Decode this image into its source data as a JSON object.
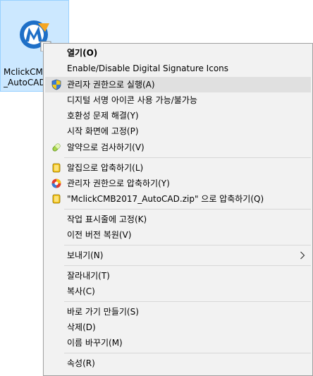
{
  "desktop_icon": {
    "label": "MclickCMB\n_AutoCAD"
  },
  "menu": {
    "items": [
      {
        "label": "열기(O)"
      },
      {
        "label": "Enable/Disable Digital Signature Icons"
      },
      {
        "label": "관리자 권한으로 실행(A)",
        "icon": "shield-icon"
      },
      {
        "label": "디지털 서명 아이콘 사용 가능/불가능"
      },
      {
        "label": "호환성 문제 해결(Y)"
      },
      {
        "label": "시작 화면에 고정(P)"
      },
      {
        "label": "알약으로 검사하기(V)",
        "icon": "pill-icon"
      },
      {
        "label": "알집으로 압축하기(L)",
        "icon": "alzip-icon"
      },
      {
        "label": "관리자 권한으로 압축하기(Y)",
        "icon": "alzip-admin-icon"
      },
      {
        "label": "\"MclickCMB2017_AutoCAD.zip\" 으로 압축하기(Q)",
        "icon": "alzip-icon"
      },
      {
        "label": "작업 표시줄에 고정(K)"
      },
      {
        "label": "이전 버전 복원(V)"
      },
      {
        "label": "보내기(N)",
        "icon": "chevron-right-icon"
      },
      {
        "label": "잘라내기(T)"
      },
      {
        "label": "복사(C)"
      },
      {
        "label": "바로 가기 만들기(S)"
      },
      {
        "label": "삭제(D)"
      },
      {
        "label": "이름 바꾸기(M)"
      },
      {
        "label": "속성(R)"
      }
    ]
  },
  "colors": {
    "menu_background": "#f2f2f2",
    "highlight": "#e0e0e0",
    "icon_selection": "#cce8ff"
  }
}
